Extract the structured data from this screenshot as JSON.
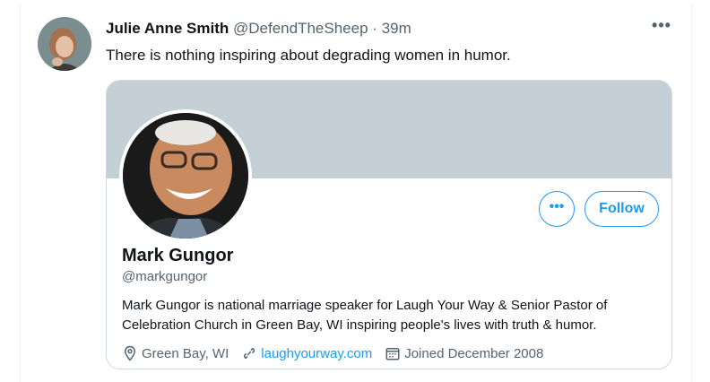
{
  "tweet": {
    "display_name": "Julie Anne Smith",
    "handle": "@DefendTheSheep",
    "separator": "·",
    "time": "39m",
    "more_label": "•••",
    "text": "There is nothing inspiring about degrading women in humor."
  },
  "card": {
    "more_label": "•••",
    "follow_label": "Follow",
    "name": "Mark Gungor",
    "handle": "@markgungor",
    "bio": "Mark Gungor is national marriage speaker for Laugh Your Way & Senior Pastor of Celebration Church in Green Bay, WI inspiring people's lives with truth & humor.",
    "location": "Green Bay, WI",
    "website": "laughyourway.com",
    "joined": "Joined December 2008"
  },
  "colors": {
    "accent": "#1d9bf0",
    "banner": "#c4cfd6",
    "secondary_text": "#536471"
  },
  "icons": [
    "location-pin-icon",
    "link-icon",
    "calendar-icon"
  ]
}
